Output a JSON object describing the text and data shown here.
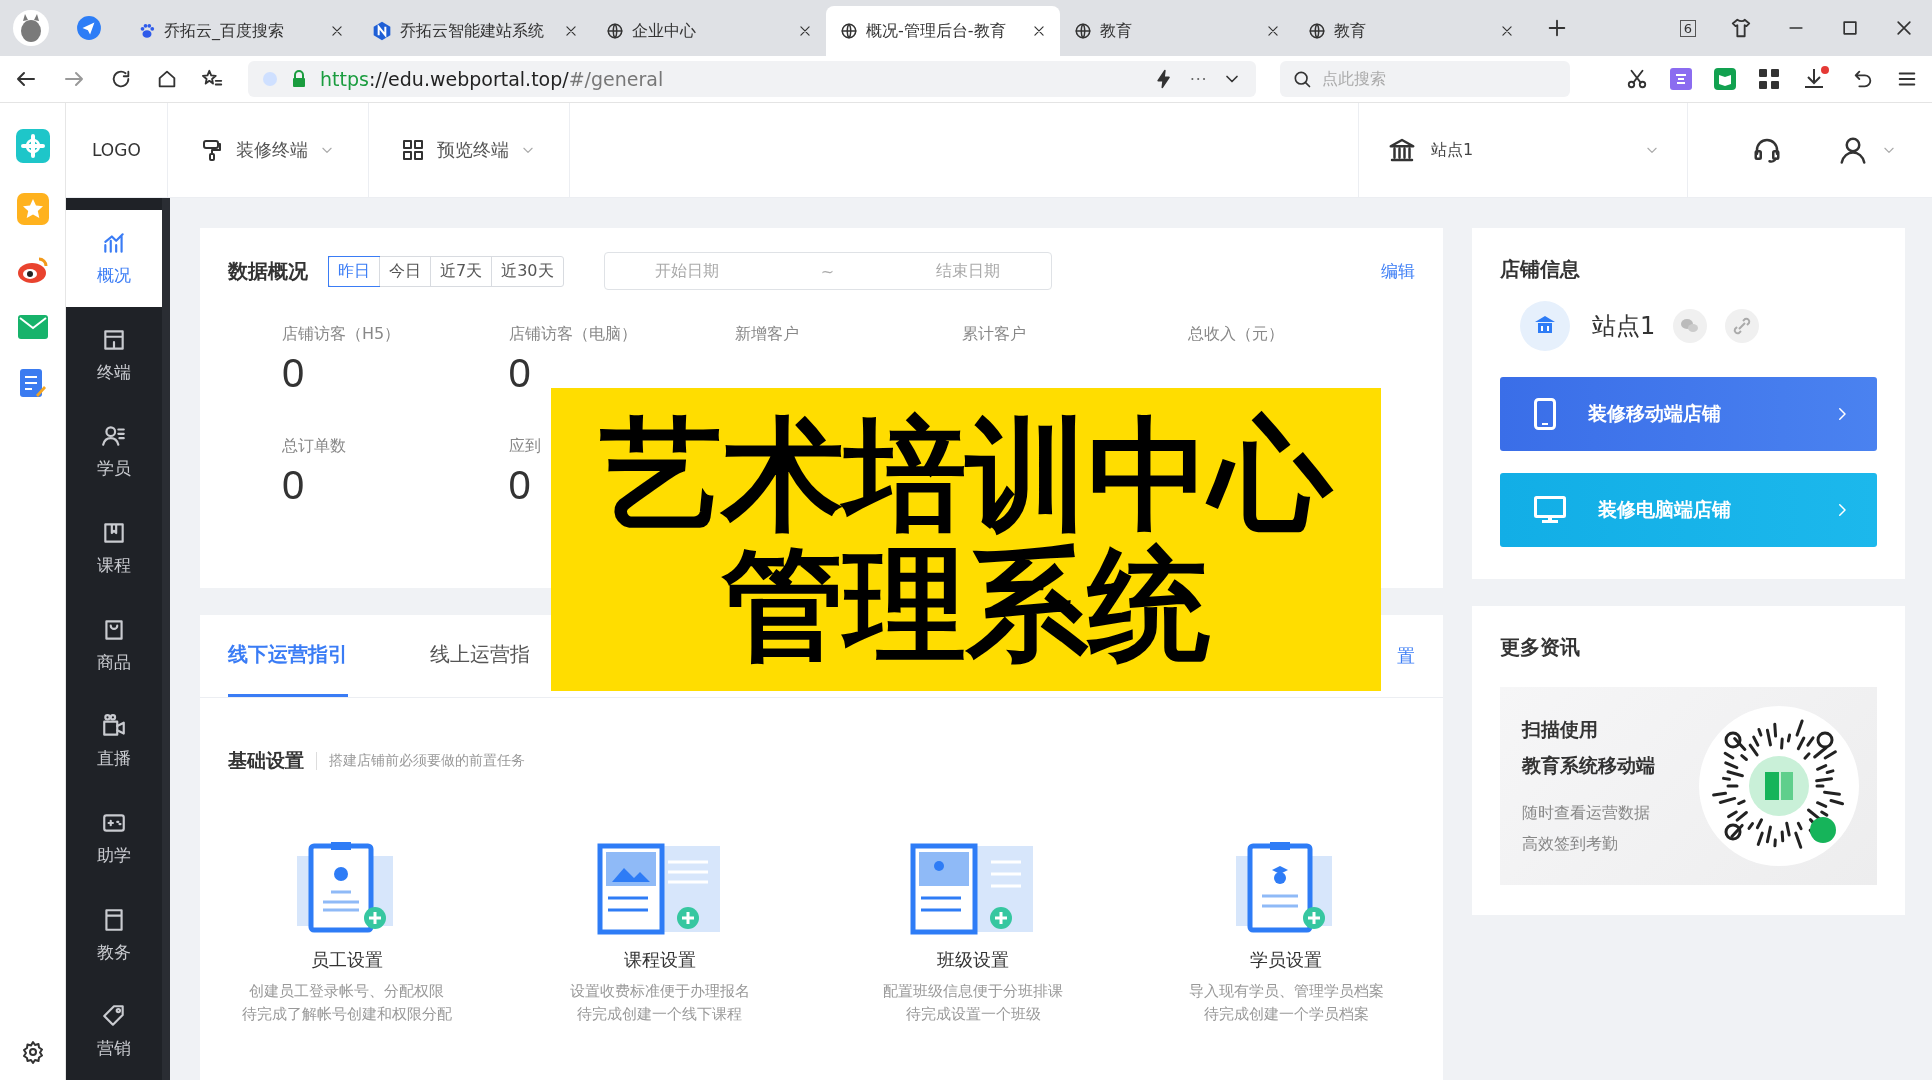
{
  "browser": {
    "tabs": [
      {
        "title": "乔拓云_百度搜索",
        "selected": false,
        "kind": "paw"
      },
      {
        "title": "乔拓云智能建站系统",
        "selected": false,
        "kind": "letter"
      },
      {
        "title": "企业中心",
        "selected": false,
        "kind": "globe"
      },
      {
        "title": "概况-管理后台-教育",
        "selected": true,
        "kind": "globe"
      },
      {
        "title": "教育",
        "selected": false,
        "kind": "globe"
      },
      {
        "title": "教育",
        "selected": false,
        "kind": "globe"
      }
    ],
    "tab_badge": "6",
    "url_scheme": "https",
    "url_rest": "://edu.webportal.top/",
    "url_hash": "#/general",
    "search_placeholder": "点此搜索"
  },
  "header": {
    "logo": "LOGO",
    "menus": [
      {
        "label": "装修终端"
      },
      {
        "label": "预览终端"
      }
    ],
    "site": "站点1"
  },
  "nav": [
    {
      "label": "概况",
      "selected": true
    },
    {
      "label": "终端",
      "selected": false
    },
    {
      "label": "学员",
      "selected": false
    },
    {
      "label": "课程",
      "selected": false
    },
    {
      "label": "商品",
      "selected": false
    },
    {
      "label": "直播",
      "selected": false
    },
    {
      "label": "助学",
      "selected": false
    },
    {
      "label": "教务",
      "selected": false
    },
    {
      "label": "营销",
      "selected": false
    }
  ],
  "overview": {
    "title": "数据概况",
    "ranges": [
      {
        "label": "昨日",
        "selected": true
      },
      {
        "label": "今日",
        "selected": false
      },
      {
        "label": "近7天",
        "selected": false
      },
      {
        "label": "近30天",
        "selected": false
      }
    ],
    "start_placeholder": "开始日期",
    "separator": "~",
    "end_placeholder": "结束日期",
    "edit": "编辑",
    "stats": [
      {
        "label": "店铺访客（H5）",
        "value": "0"
      },
      {
        "label": "店铺访客（电脑）",
        "value": "0"
      },
      {
        "label": "新增客户"
      },
      {
        "label": "累计客户"
      },
      {
        "label": "总收入（元）"
      },
      {
        "label": "总订单数",
        "value": "0"
      },
      {
        "label": "应到",
        "value": "0"
      }
    ]
  },
  "guide": {
    "tabs": [
      {
        "label": "线下运营指引",
        "selected": true
      },
      {
        "label": "线上运营指",
        "selected": false
      }
    ],
    "link": "置",
    "section_title": "基础设置",
    "section_hint": "搭建店铺前必须要做的前置任务",
    "tasks": [
      {
        "title": "员工设置",
        "desc": "创建员工登录帐号、分配权限",
        "status": "待完成了解帐号创建和权限分配"
      },
      {
        "title": "课程设置",
        "desc": "设置收费标准便于办理报名",
        "status": "待完成创建一个线下课程"
      },
      {
        "title": "班级设置",
        "desc": "配置班级信息便于分班排课",
        "status": "待完成设置一个班级"
      },
      {
        "title": "学员设置",
        "desc": "导入现有学员、管理学员档案",
        "status": "待完成创建一个学员档案"
      }
    ]
  },
  "store": {
    "title": "店铺信息",
    "name": "站点1",
    "actions": [
      {
        "label": "装修移动端店铺",
        "kind": "mobile"
      },
      {
        "label": "装修电脑端店铺",
        "kind": "desktop"
      }
    ]
  },
  "news": {
    "title": "更多资讯",
    "headings": [
      "扫描使用",
      "教育系统移动端"
    ],
    "lines": [
      "随时查看运营数据",
      "高效签到考勤"
    ]
  },
  "overlay": {
    "lines": [
      "艺术培训中心",
      "管理系统"
    ]
  }
}
